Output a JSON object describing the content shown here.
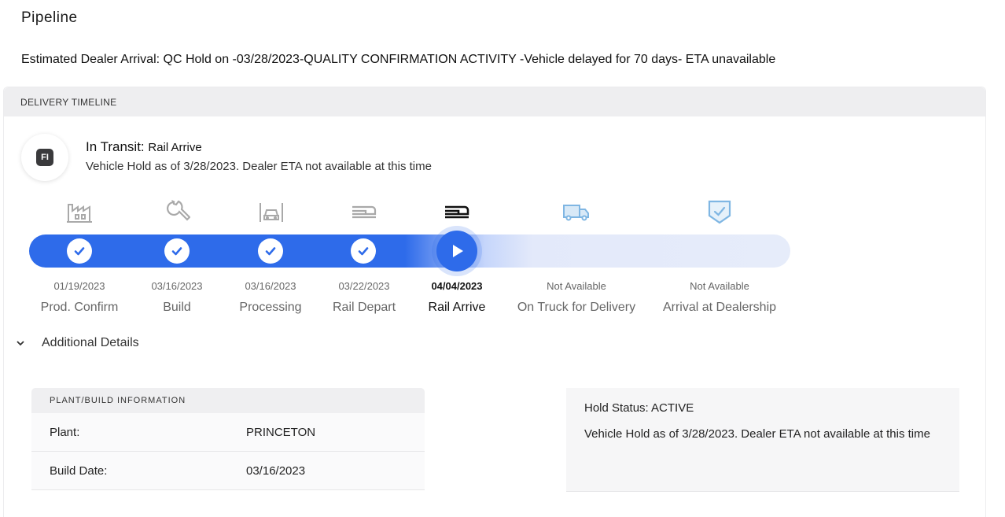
{
  "page": {
    "title": "Pipeline",
    "eta_line": "Estimated Dealer Arrival: QC Hold on -03/28/2023-QUALITY CONFIRMATION ACTIVITY -Vehicle delayed for 70 days- ETA unavailable"
  },
  "timeline": {
    "header": "DELIVERY TIMELINE",
    "badge": "FI",
    "status_label": "In Transit:",
    "status_value": "Rail Arrive",
    "status_message": "Vehicle Hold as of 3/28/2023. Dealer ETA not available at this time",
    "steps": [
      {
        "date": "01/19/2023",
        "label": "Prod. Confirm",
        "icon": "factory-icon",
        "state": "complete"
      },
      {
        "date": "03/16/2023",
        "label": "Build",
        "icon": "wrench-icon",
        "state": "complete"
      },
      {
        "date": "03/16/2023",
        "label": "Processing",
        "icon": "car-garage-icon",
        "state": "complete"
      },
      {
        "date": "03/22/2023",
        "label": "Rail Depart",
        "icon": "rail-car-icon",
        "state": "complete"
      },
      {
        "date": "04/04/2023",
        "label": "Rail Arrive",
        "icon": "rail-car-icon",
        "state": "current"
      },
      {
        "date": "Not Available",
        "label": "On Truck for Delivery",
        "icon": "truck-icon",
        "state": "pending"
      },
      {
        "date": "Not Available",
        "label": "Arrival at Dealership",
        "icon": "shield-check-icon",
        "state": "pending"
      }
    ],
    "colors": {
      "accent": "#2e6bea",
      "pending_icon": "#7fb6e3",
      "done_icon": "#a9a9a9"
    }
  },
  "details": {
    "toggle_label": "Additional Details",
    "plant_header": "PLANT/BUILD INFORMATION",
    "rows": [
      {
        "key": "Plant:",
        "value": "PRINCETON"
      },
      {
        "key": "Build Date:",
        "value": "03/16/2023"
      }
    ],
    "hold_status": "Hold Status: ACTIVE",
    "hold_message": "Vehicle Hold as of 3/28/2023. Dealer ETA not available at this time"
  }
}
